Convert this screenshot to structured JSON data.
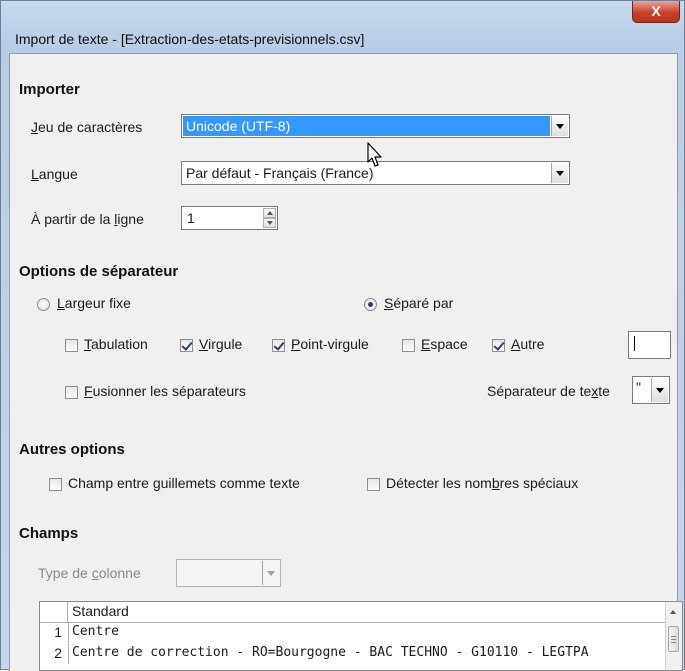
{
  "window": {
    "title": "Import de texte - [Extraction-des-etats-previsionnels.csv]",
    "close_glyph": "X"
  },
  "importer": {
    "section_title": "Importer",
    "charset": {
      "label_u": "J",
      "label_rest": "eu de caractères",
      "value": "Unicode (UTF-8)"
    },
    "language": {
      "label_u": "L",
      "label_rest": "angue",
      "value": "Par défaut - Français (France)"
    },
    "from_row": {
      "label_pre": "À partir de la ",
      "label_u": "l",
      "label_rest": "igne",
      "value": "1"
    }
  },
  "separator": {
    "section_title": "Options de séparateur",
    "fixed_width": {
      "label_u": "L",
      "label_rest": "argeur fixe",
      "selected": false
    },
    "separated_by": {
      "label_u": "S",
      "label_rest": "éparé par",
      "selected": true
    },
    "options": {
      "tab": {
        "label_u": "T",
        "label_rest": "abulation",
        "checked": false
      },
      "comma": {
        "label_u": "V",
        "label_rest": "irgule",
        "checked": true
      },
      "semicolon": {
        "label_u": "P",
        "label_rest": "oint-virgule",
        "checked": true
      },
      "space": {
        "label_u": "E",
        "label_rest": "space",
        "checked": false
      },
      "other": {
        "label_u": "A",
        "label_rest": "utre",
        "checked": true
      }
    },
    "other_value": "",
    "merge": {
      "label_u": "F",
      "label_rest": "usionner les séparateurs",
      "checked": false
    },
    "text_delimiter": {
      "label_pre": "Séparateur de te",
      "label_u": "x",
      "label_rest": "te",
      "value": "\""
    }
  },
  "other_options": {
    "section_title": "Autres options",
    "quoted_as_text": {
      "label_pre": "Champ entre ",
      "label_u": "g",
      "label_rest": "uillemets comme texte",
      "checked": false
    },
    "detect_special": {
      "label_pre": "Détecter les nom",
      "label_u": "b",
      "label_rest": "res spéciaux",
      "checked": false
    }
  },
  "fields": {
    "section_title": "Champs",
    "column_type": {
      "label_pre": "Type de ",
      "label_u": "c",
      "label_rest": "olonne",
      "value": ""
    },
    "preview": {
      "column_header": "Standard",
      "rows": [
        {
          "num": "1",
          "text": "Centre"
        },
        {
          "num": "2",
          "text": "Centre de correction - RO=Bourgogne - BAC TECHNO - G10110 - LEGTPA"
        }
      ]
    }
  },
  "colors": {
    "selection": "#3399ff",
    "check_mark": "#2a3f7c",
    "close_button": "#c8432c"
  }
}
